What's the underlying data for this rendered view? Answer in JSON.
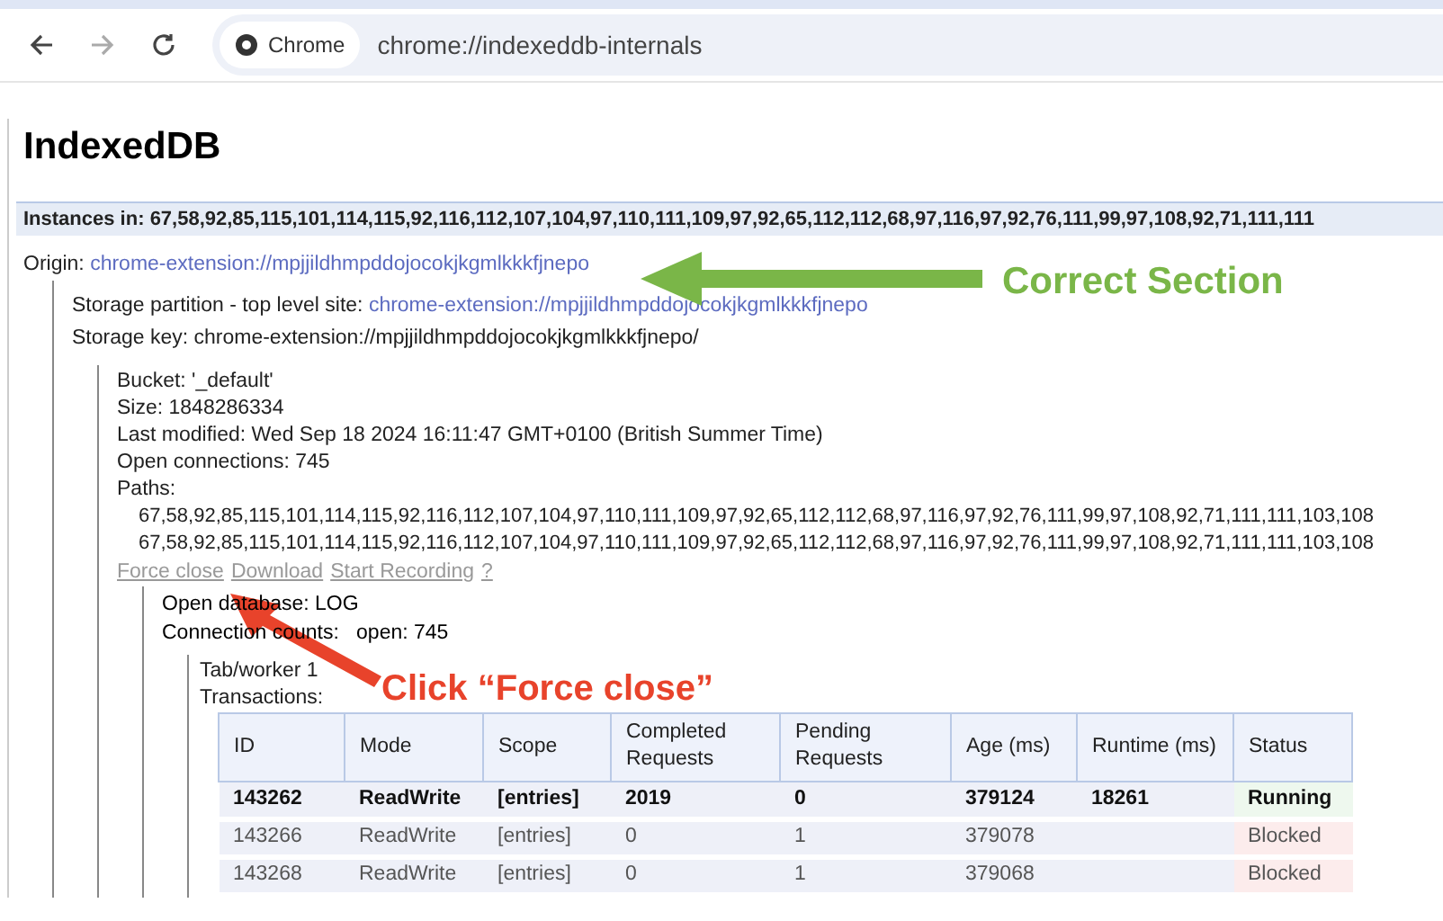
{
  "toolbar": {
    "chip": "Chrome",
    "url": "chrome://indexeddb-internals"
  },
  "heading": "IndexedDB",
  "instances": {
    "label": "Instances in:",
    "value": "67,58,92,85,115,101,114,115,92,116,112,107,104,97,110,111,109,97,92,65,112,112,68,97,116,97,92,76,111,99,97,108,92,71,111,111"
  },
  "origin": {
    "label": "Origin:",
    "link": "chrome-extension://mpjjildhmpddojocokjkgmlkkkfjnepo"
  },
  "partition": {
    "label": "Storage partition - top level site:",
    "link": "chrome-extension://mpjjildhmpddojocokjkgmlkkkfjnepo"
  },
  "storage_key": "Storage key: chrome-extension://mpjjildhmpddojocokjkgmlkkkfjnepo/",
  "bucket": {
    "lines": [
      "Bucket: '_default'",
      "Size: 1848286334",
      "Last modified: Wed Sep 18 2024 16:11:47 GMT+0100 (British Summer Time)",
      "Open connections: 745",
      "Paths:"
    ],
    "paths": [
      "67,58,92,85,115,101,114,115,92,116,112,107,104,97,110,111,109,97,92,65,112,112,68,97,116,97,92,76,111,99,97,108,92,71,111,111,103,108",
      "67,58,92,85,115,101,114,115,92,116,112,107,104,97,110,111,109,97,92,65,112,112,68,97,116,97,92,76,111,99,97,108,92,71,111,111,103,108"
    ],
    "links": [
      "Force close",
      "Download",
      "Start Recording",
      "?"
    ]
  },
  "database": {
    "lines": [
      "Open database: LOG",
      "Connection counts:   open: 745"
    ]
  },
  "worker": {
    "lines": [
      "Tab/worker 1",
      "Transactions:"
    ]
  },
  "table": {
    "columns": [
      "ID",
      "Mode",
      "Scope",
      "Completed Requests",
      "Pending Requests",
      "Age (ms)",
      "Runtime (ms)",
      "Status"
    ],
    "rows": [
      {
        "active": true,
        "cells": [
          "143262",
          "ReadWrite",
          "[entries]",
          "2019",
          "0",
          "379124",
          "18261",
          "Running"
        ]
      },
      {
        "active": false,
        "cells": [
          "143266",
          "ReadWrite",
          "[entries]",
          "0",
          "1",
          "379078",
          "",
          "Blocked"
        ]
      },
      {
        "active": false,
        "cells": [
          "143268",
          "ReadWrite",
          "[entries]",
          "0",
          "1",
          "379068",
          "",
          "Blocked"
        ]
      }
    ]
  },
  "annotations": [
    {
      "kind": "green",
      "text": "Correct Section"
    },
    {
      "kind": "red",
      "text": "Click “Force close”"
    }
  ]
}
